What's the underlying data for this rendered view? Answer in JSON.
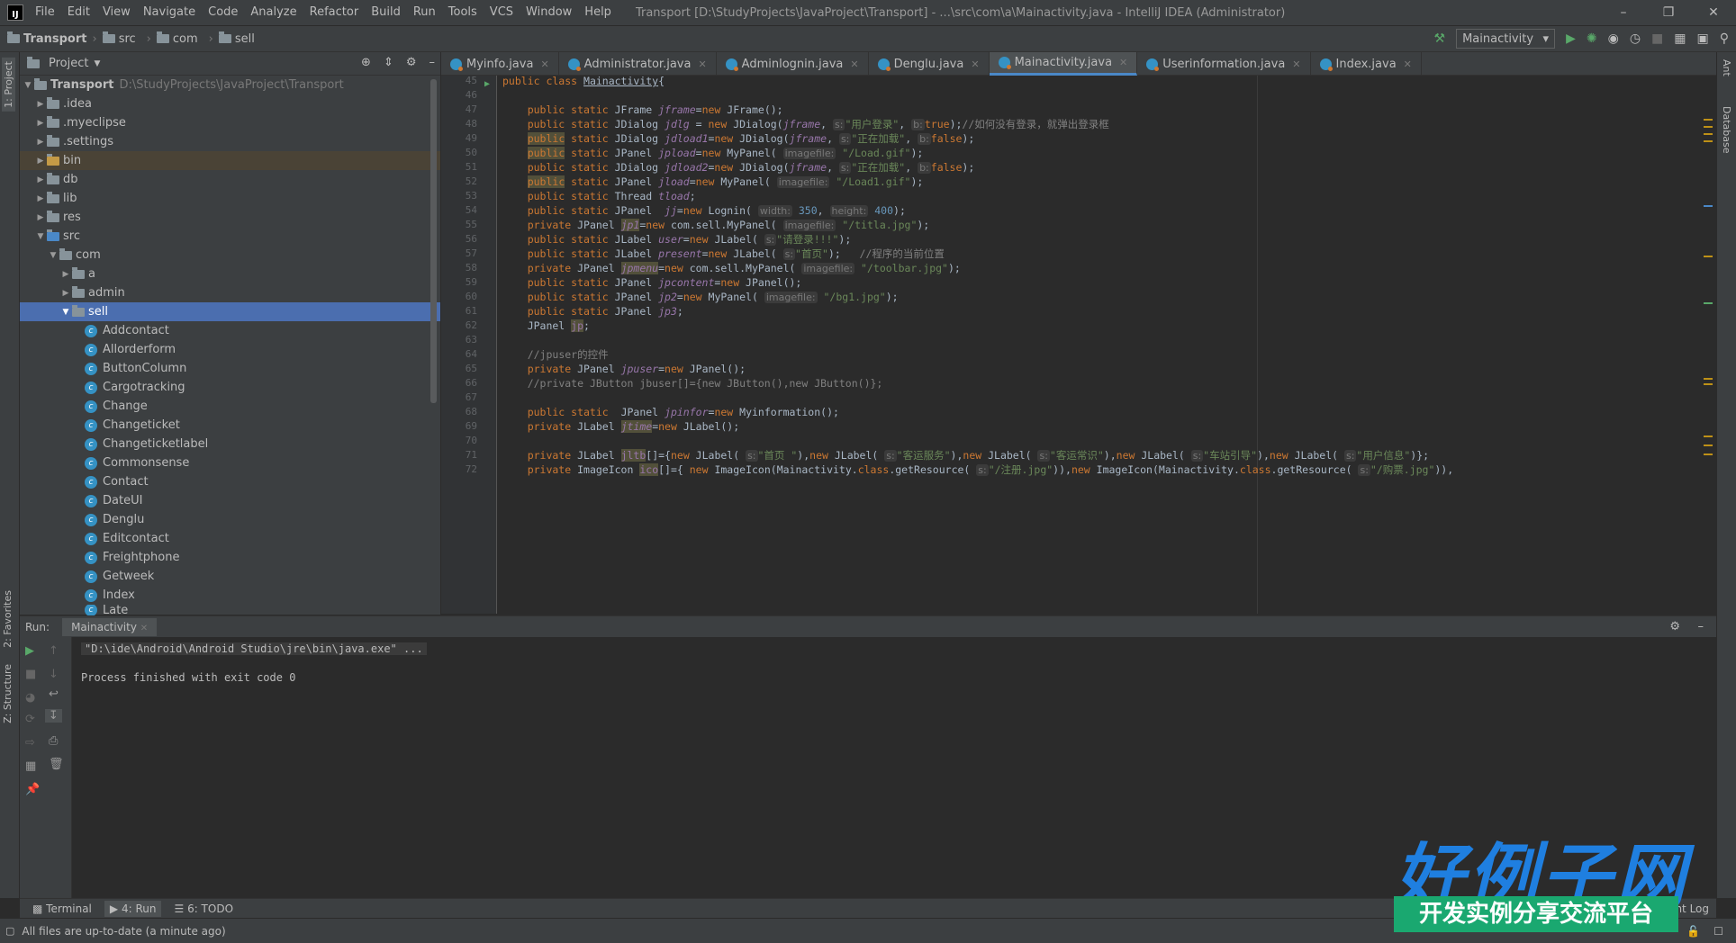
{
  "window": {
    "logo": "IJ",
    "title": "Transport [D:\\StudyProjects\\JavaProject\\Transport] - ...\\src\\com\\a\\Mainactivity.java - IntelliJ IDEA (Administrator)",
    "menu": [
      "File",
      "Edit",
      "View",
      "Navigate",
      "Code",
      "Analyze",
      "Refactor",
      "Build",
      "Run",
      "Tools",
      "VCS",
      "Window",
      "Help"
    ]
  },
  "breadcrumb": [
    "Transport",
    "src",
    "com",
    "sell"
  ],
  "toolbar": {
    "run_config": "Mainactivity"
  },
  "project": {
    "title": "Project",
    "root": "Transport",
    "root_path": "D:\\StudyProjects\\JavaProject\\Transport",
    "items": [
      ".idea",
      ".myeclipse",
      ".settings",
      "bin",
      "db",
      "lib",
      "res",
      "src",
      "com",
      "a",
      "admin",
      "sell"
    ],
    "classes": [
      "Addcontact",
      "Allorderform",
      "ButtonColumn",
      "Cargotracking",
      "Change",
      "Changeticket",
      "Changeticketlabel",
      "Commonsense",
      "Contact",
      "DateUI",
      "Denglu",
      "Editcontact",
      "Freightphone",
      "Getweek",
      "Index",
      "Late"
    ]
  },
  "tabs": [
    "Myinfo.java",
    "Administrator.java",
    "Adminlognin.java",
    "Denglu.java",
    "Mainactivity.java",
    "Userinformation.java",
    "Index.java"
  ],
  "side": {
    "project": "1: Project",
    "favorites": "2: Favorites",
    "structure": "Z: Structure",
    "ant": "Ant",
    "database": "Database"
  },
  "editor": {
    "line_numbers": [
      "45",
      "46",
      "47",
      "48",
      "49",
      "50",
      "51",
      "52",
      "53",
      "54",
      "55",
      "56",
      "57",
      "58",
      "59",
      "60",
      "61",
      "62",
      "63",
      "64",
      "65",
      "66",
      "67",
      "68",
      "69",
      "70",
      "71",
      "72"
    ],
    "code": {
      "l45a": "public class ",
      "l45b": "Mainactivity",
      "l45c": "{",
      "l47": "    public static JFrame ",
      "l47v": "jframe",
      "l47e": "=new JFrame();",
      "l48": "    public static JDialog ",
      "l48v": "jdlg",
      "l48e": " = new JDialog(",
      "l48v2": "jframe",
      ", ": ", ",
      "l48h": "s:",
      "l48s": "\"用户登录\"",
      "l48h2": "b:",
      "l48t": " true);",
      "l48c": "//如何没有登录，就弹出登录框",
      "l49s": "\"正在加载\"",
      "l49t": " false);",
      "l50s": "\"/Load.gif\"",
      "l52s": "\"/Load1.gif\"",
      "l53v": "tload",
      "l54h1": "width:",
      "l54n1": "350",
      "l54h2": "height:",
      "l54n2": "400",
      "l55s": "\"/titla.jpg\"",
      "l56s": "\"请登录!!!\"",
      "l57s": "\"首页\"",
      "l57c": "//程序的当前位置",
      "l58s": "\"/toolbar.jpg\"",
      "l60s": "\"/bg1.jpg\"",
      "l64": "//jpuser的控件",
      "l66": "//private JButton jbuser[]={new JButton(),new JButton()};",
      "l71s1": "\"首页 \"",
      "l71s2": "\"客运服务\"",
      "l71s3": "\"客运常识\"",
      "l71s4": "\"车站引导\"",
      "l71s5": "\"用户信息\"",
      "l72s1": "\"/注册.jpg\"",
      "l72s2": "\"/购票.jpg\""
    }
  },
  "run": {
    "label": "Run:",
    "tab": "Mainactivity",
    "cmd": "\"D:\\ide\\Android\\Android Studio\\jre\\bin\\java.exe\" ...",
    "finished": "Process finished with exit code 0"
  },
  "bottom": {
    "terminal": "Terminal",
    "run": "4: Run",
    "todo": "6: TODO",
    "event_log": "Event Log"
  },
  "status": {
    "text": "All files are up-to-date (a minute ago)"
  },
  "watermark": {
    "main": "好例子网",
    "sub": "开发实例分享交流平台"
  }
}
